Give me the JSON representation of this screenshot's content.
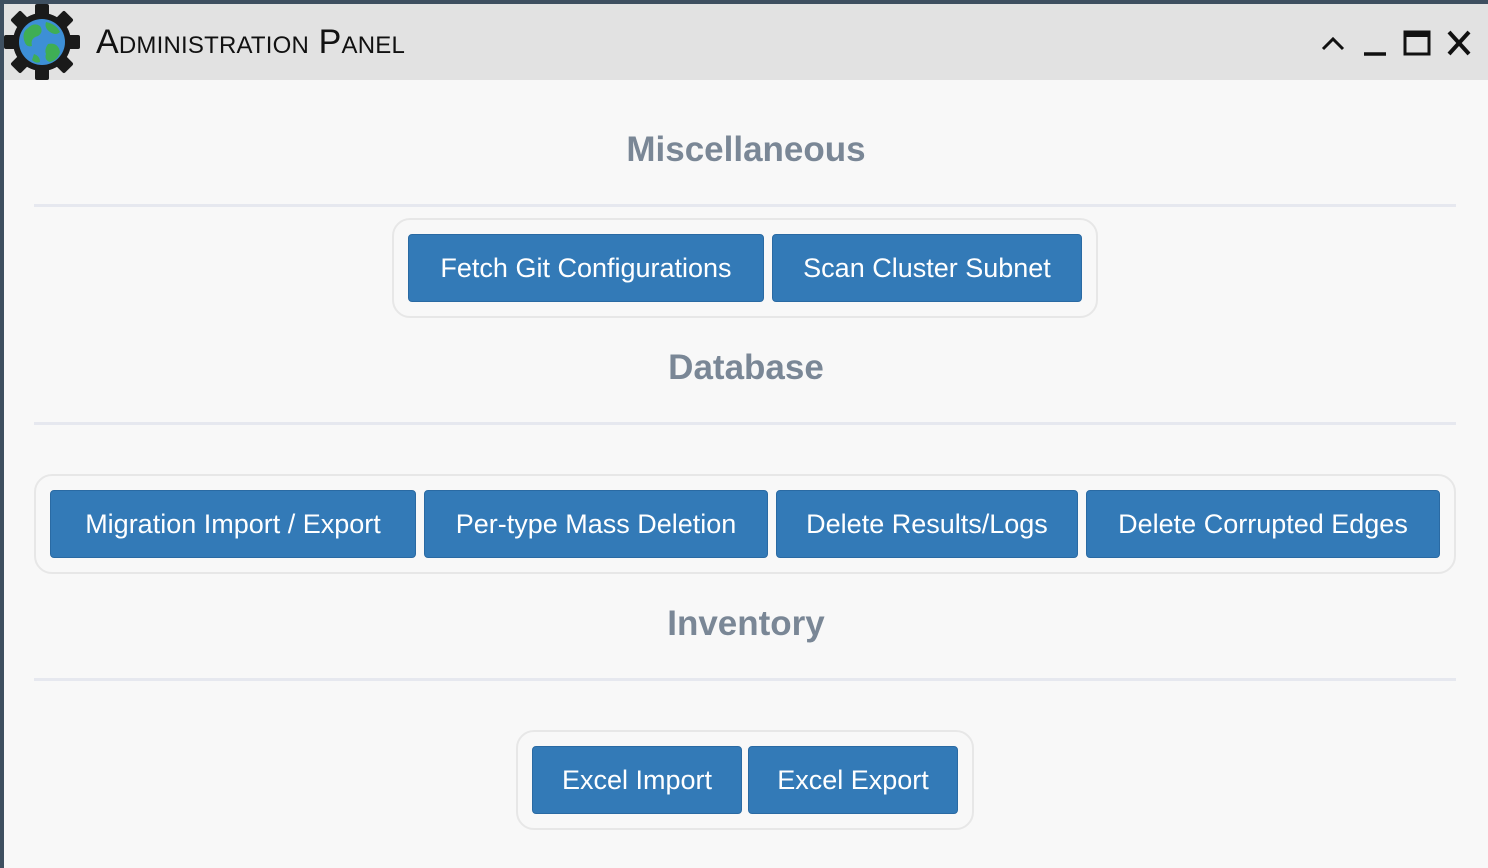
{
  "window": {
    "title": "Administration Panel"
  },
  "titlebar_controls": [
    "collapse-icon",
    "minimize-icon",
    "maximize-icon",
    "close-icon"
  ],
  "sections": [
    {
      "title": "Miscellaneous",
      "buttons": [
        "Fetch Git Configurations",
        "Scan Cluster Subnet"
      ]
    },
    {
      "title": "Database",
      "buttons": [
        "Migration Import / Export",
        "Per-type Mass Deletion",
        "Delete Results/Logs",
        "Delete Corrupted Edges"
      ]
    },
    {
      "title": "Inventory",
      "buttons": [
        "Excel Import",
        "Excel Export"
      ]
    }
  ],
  "colors": {
    "button": "#337ab7",
    "section_title": "#7a8796",
    "titlebar": "#e2e2e2"
  }
}
